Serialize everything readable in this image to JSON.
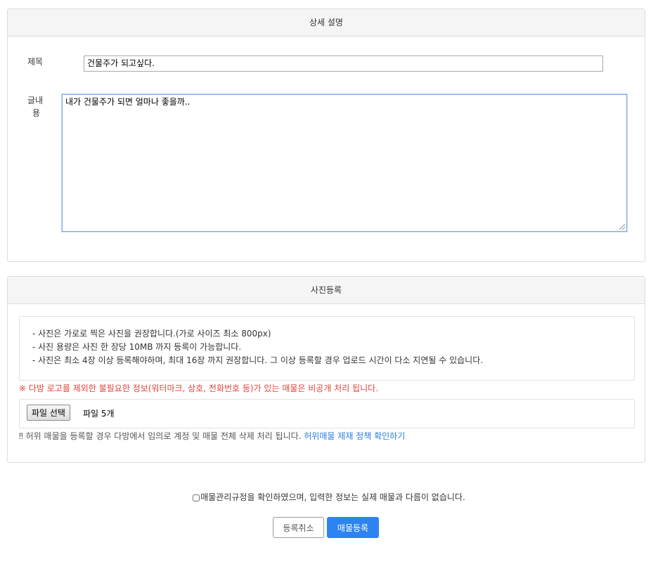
{
  "detail": {
    "header": "상세 설명",
    "title_label": "제목",
    "title_value": "건물주가 되고싶다.",
    "content_label_line1": "글내",
    "content_label_line2": "용",
    "content_value": "내가 건물주가 되면 얼마나 좋을까.."
  },
  "photo": {
    "header": "사진등록",
    "info_lines": [
      "- 사진은 가로로 찍은 사진을 권장합니다.(가로 사이즈 최소 800px)",
      "- 사진 용량은 사진 한 장당 10MB 까지 등록이 가능합니다.",
      "- 사진은 최소 4장 이상 등록해야하며, 최대 16장 까지 권장합니다. 그 이상 등록할 경우 업로드 시간이 다소 지연될 수 있습니다."
    ],
    "warning_red": "※ 다방 로고를 제외한 불필요한 정보(워터마크, 상호, 전화번호 등)가 있는 매물은 비공개 처리 됩니다.",
    "file_button": "파일 선택",
    "file_count": "파일 5개",
    "warning_gray": "‼ 허위 매물을 등록할 경우 다방에서 임의로 계정 및 매물 전체 삭제 처리 됩니다.",
    "policy_link": "허위매물 제재 정책 확인하기"
  },
  "agreement": {
    "text": "매물관리규정을 확인하였으며, 입력한 정보는 실제 매물과 다름이 없습니다.",
    "checked": false
  },
  "actions": {
    "cancel": "등록취소",
    "submit": "매물등록"
  }
}
